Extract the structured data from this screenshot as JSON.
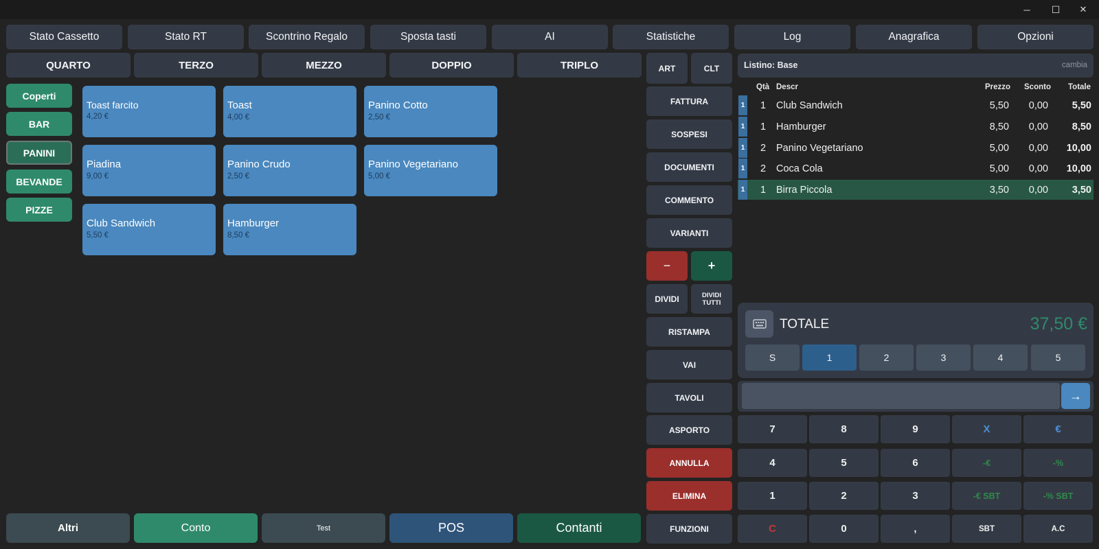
{
  "window": {
    "minimize_glyph": "─",
    "maximize_glyph": "☐",
    "close_glyph": "✕"
  },
  "top_buttons": [
    "Stato Cassetto",
    "Stato RT",
    "Scontrino Regalo",
    "Sposta tasti",
    "AI",
    "Statistiche",
    "Log",
    "Anagrafica",
    "Opzioni"
  ],
  "size_buttons": [
    "QUARTO",
    "TERZO",
    "MEZZO",
    "DOPPIO",
    "TRIPLO"
  ],
  "categories": [
    {
      "label": "Coperti"
    },
    {
      "label": "BAR"
    },
    {
      "label": "PANINI",
      "active": true
    },
    {
      "label": "BEVANDE"
    },
    {
      "label": "PIZZE"
    }
  ],
  "products": [
    {
      "name": "Toast farcito",
      "price": "4,20 €"
    },
    {
      "name": "Toast",
      "price": "4,00 €"
    },
    {
      "name": "Panino Cotto",
      "price": "2,50 €"
    },
    {
      "name": "Piadina",
      "price": "9,00 €"
    },
    {
      "name": "Panino Crudo",
      "price": "2,50 €"
    },
    {
      "name": "Panino Vegetariano",
      "price": "5,00 €"
    },
    {
      "name": "Club Sandwich",
      "price": "5,50 €"
    },
    {
      "name": "Hamburger",
      "price": "8,50 €"
    }
  ],
  "side": {
    "art": "ART",
    "clt": "CLT",
    "fattura": "FATTURA",
    "sospesi": "SOSPESI",
    "documenti": "DOCUMENTI",
    "commento": "COMMENTO",
    "varianti": "VARIANTI",
    "minus": "−",
    "plus": "+",
    "dividi": "DIVIDI",
    "dividi_tutti_1": "DIVIDI",
    "dividi_tutti_2": "TUTTI",
    "ristampa": "RISTAMPA",
    "vai": "VAI",
    "tavoli": "TAVOLI",
    "asporto": "ASPORTO",
    "annulla": "ANNULLA",
    "elimina": "ELIMINA",
    "funzioni": "FUNZIONI"
  },
  "listino": {
    "label": "Listino: Base",
    "change": "cambia"
  },
  "order_headers": {
    "qty": "Qtà",
    "descr": "Descr",
    "price": "Prezzo",
    "discount": "Sconto",
    "total": "Totale"
  },
  "order_rows": [
    {
      "tag": "1",
      "qty": "1",
      "descr": "Club Sandwich",
      "price": "5,50",
      "discount": "0,00",
      "total": "5,50"
    },
    {
      "tag": "1",
      "qty": "1",
      "descr": "Hamburger",
      "price": "8,50",
      "discount": "0,00",
      "total": "8,50"
    },
    {
      "tag": "1",
      "qty": "2",
      "descr": "Panino Vegetariano",
      "price": "5,00",
      "discount": "0,00",
      "total": "10,00"
    },
    {
      "tag": "1",
      "qty": "2",
      "descr": "Coca Cola",
      "price": "5,00",
      "discount": "0,00",
      "total": "10,00"
    },
    {
      "tag": "1",
      "qty": "1",
      "descr": "Birra Piccola",
      "price": "3,50",
      "discount": "0,00",
      "total": "3,50",
      "selected": true
    }
  ],
  "totale": {
    "label": "TOTALE",
    "amount": "37,50 €"
  },
  "split_buttons": [
    "S",
    "1",
    "2",
    "3",
    "4",
    "5"
  ],
  "input": {
    "value": "",
    "submit_glyph": "→"
  },
  "keypad": [
    [
      "7",
      "8",
      "9",
      "X",
      "€"
    ],
    [
      "4",
      "5",
      "6",
      "-€",
      "-%"
    ],
    [
      "1",
      "2",
      "3",
      "-€ SBT",
      "-% SBT"
    ],
    [
      "C",
      "0",
      ",",
      "SBT",
      "A.C"
    ]
  ],
  "bottom_buttons": [
    "Altri",
    "Conto",
    "Test",
    "POS",
    "Contanti"
  ],
  "colors": {
    "accent_blue": "#4a88bf",
    "accent_green": "#2f8a6b",
    "danger": "#9a2f2c",
    "total_green": "#2f8a6b"
  }
}
